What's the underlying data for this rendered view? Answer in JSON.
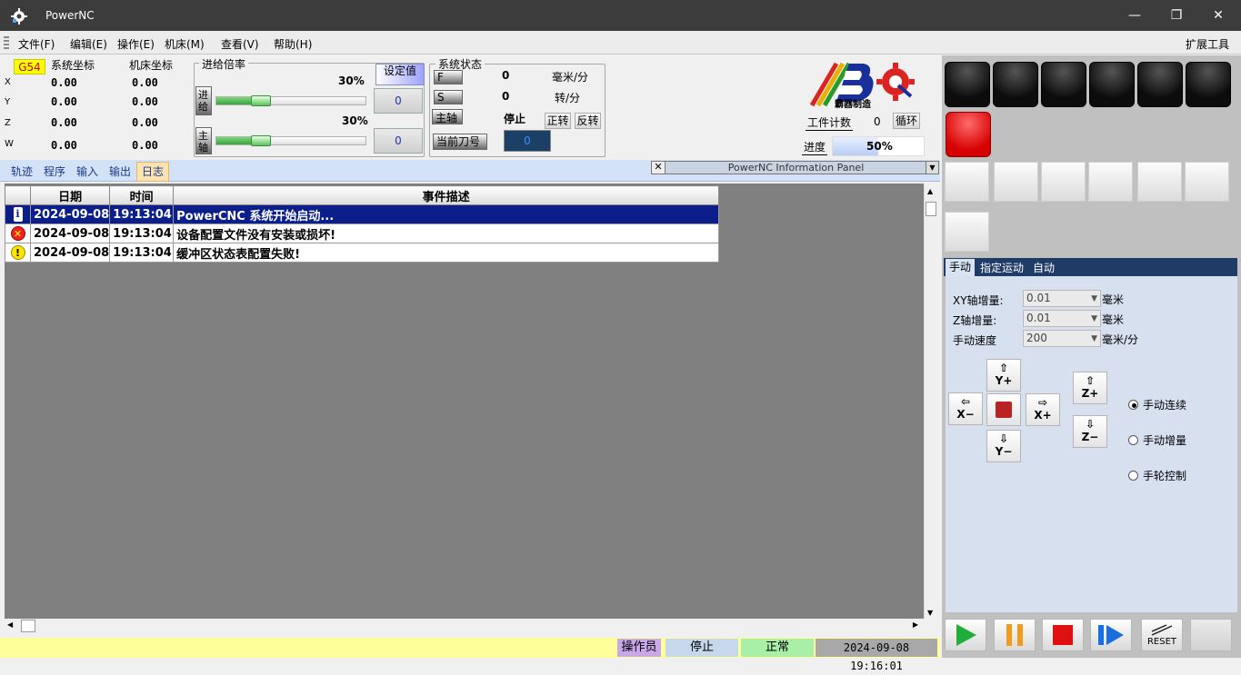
{
  "window": {
    "title": "PowerNC",
    "minimize": "—",
    "maximize": "❐",
    "close": "✕"
  },
  "menu": {
    "file": "文件(F)",
    "edit": "编辑(E)",
    "operate": "操作(E)",
    "machine": "机床(M)",
    "view": "查看(V)",
    "help": "帮助(H)",
    "extend": "扩展工具"
  },
  "coords": {
    "g54": "G54",
    "sys_label": "系统坐标",
    "mach_label": "机床坐标",
    "axes": [
      {
        "name": "X",
        "sys": "0.00",
        "mach": "0.00"
      },
      {
        "name": "Y",
        "sys": "0.00",
        "mach": "0.00"
      },
      {
        "name": "Z",
        "sys": "0.00",
        "mach": "0.00"
      },
      {
        "name": "W",
        "sys": "0.00",
        "mach": "0.00"
      }
    ]
  },
  "feed_rate": {
    "title": "进给倍率",
    "set_label": "设定值",
    "feed": {
      "label_a": "进",
      "label_b": "给",
      "percent": "30%",
      "level": 0.3,
      "value": "0"
    },
    "spindle": {
      "label_a": "主",
      "label_b": "轴",
      "percent": "30%",
      "level": 0.3,
      "value": "0"
    }
  },
  "sys_status": {
    "title": "系统状态",
    "f_label": "F",
    "f_value": "0",
    "f_unit": "毫米/分",
    "s_label": "S",
    "s_value": "0",
    "s_unit": "转/分",
    "spindle_label": "主轴",
    "spindle_state": "停止",
    "forward": "正转",
    "reverse": "反转",
    "tool_label": "当前刀号",
    "tool_value": "0"
  },
  "brand": {
    "caption": "霸器制造"
  },
  "counter": {
    "label": "工件计数",
    "value": "0",
    "loop": "循环",
    "progress_label": "进度",
    "progress": "50%",
    "level": 0.5
  },
  "tabs": [
    "轨迹",
    "程序",
    "输入",
    "输出",
    "日志"
  ],
  "info_panel": {
    "title": "PowerNC Information Panel",
    "close": "✕",
    "drop": "▼"
  },
  "log": {
    "headers": [
      "日期",
      "时间",
      "事件描述"
    ],
    "rows": [
      {
        "icon": "info-icon",
        "date": "2024-09-08",
        "time": "19:13:04",
        "desc": "PowerCNC 系统开始启动..."
      },
      {
        "icon": "error-icon",
        "date": "2024-09-08",
        "time": "19:13:04",
        "desc": "设备配置文件没有安装或损坏!"
      },
      {
        "icon": "warning-icon",
        "date": "2024-09-08",
        "time": "19:13:04",
        "desc": "缓冲区状态表配置失败!"
      }
    ]
  },
  "status_bar": {
    "user": "操作员",
    "state": "停止",
    "health": "正常",
    "datetime": "2024-09-08 19:16:01"
  },
  "right_tabs": [
    "手动",
    "指定运动",
    "自动"
  ],
  "manual": {
    "xy_label": "XY轴增量:",
    "xy_value": "0.01",
    "xy_unit": "毫米",
    "z_label": "Z轴增量:",
    "z_value": "0.01",
    "z_unit": "毫米",
    "speed_label": "手动速度",
    "speed_value": "200",
    "speed_unit": "毫米/分",
    "jog": {
      "y_plus": "Y+",
      "y_minus": "Y−",
      "x_plus": "X+",
      "x_minus": "X−",
      "z_plus": "Z+",
      "z_minus": "Z−"
    },
    "modes": [
      "手动连续",
      "手动增量",
      "手轮控制"
    ],
    "selected_mode": 0
  },
  "bottom_buttons": {
    "reset": "RESET"
  },
  "colors": {
    "title_bar": "#3c3c3c",
    "selected_row": "#0b1e8a",
    "status_bar": "#ffff99",
    "tab_active": "#fbe3b3"
  }
}
